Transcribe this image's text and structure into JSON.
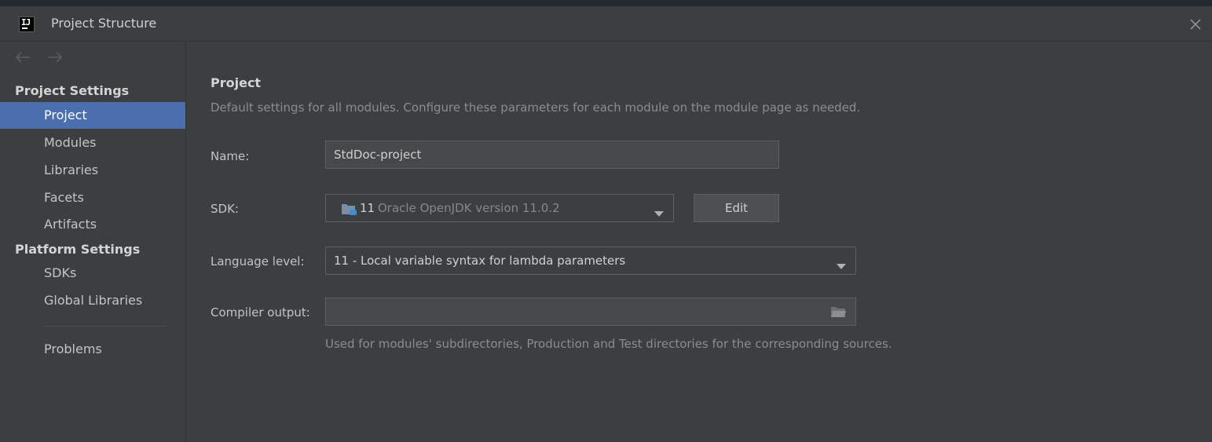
{
  "window": {
    "title": "Project Structure",
    "app_icon_text": "IJ"
  },
  "sidebar": {
    "sections": [
      {
        "header": "Project Settings",
        "items": [
          {
            "label": "Project",
            "selected": true
          },
          {
            "label": "Modules"
          },
          {
            "label": "Libraries"
          },
          {
            "label": "Facets"
          },
          {
            "label": "Artifacts"
          }
        ]
      },
      {
        "header": "Platform Settings",
        "items": [
          {
            "label": "SDKs"
          },
          {
            "label": "Global Libraries"
          }
        ]
      }
    ],
    "problems_label": "Problems"
  },
  "main": {
    "title": "Project",
    "description": "Default settings for all modules. Configure these parameters for each module on the module page as needed.",
    "name_label": "Name:",
    "name_value": "StdDoc-project",
    "sdk_label": "SDK:",
    "sdk_version": "11",
    "sdk_name": "Oracle OpenJDK version 11.0.2",
    "edit_label": "Edit",
    "language_label": "Language level:",
    "language_value": "11 - Local variable syntax for lambda parameters",
    "compiler_label": "Compiler output:",
    "compiler_value": "",
    "compiler_hint": "Used for modules' subdirectories, Production and Test directories for the corresponding sources."
  },
  "icons": {
    "close": "close-icon",
    "back": "arrow-left-icon",
    "forward": "arrow-right-icon",
    "folder": "folder-icon",
    "dropdown": "chevron-down-icon"
  },
  "colors": {
    "background": "#3c3f41",
    "selection": "#4b6eaf",
    "input_background": "#45494a",
    "border": "#5e6060"
  }
}
